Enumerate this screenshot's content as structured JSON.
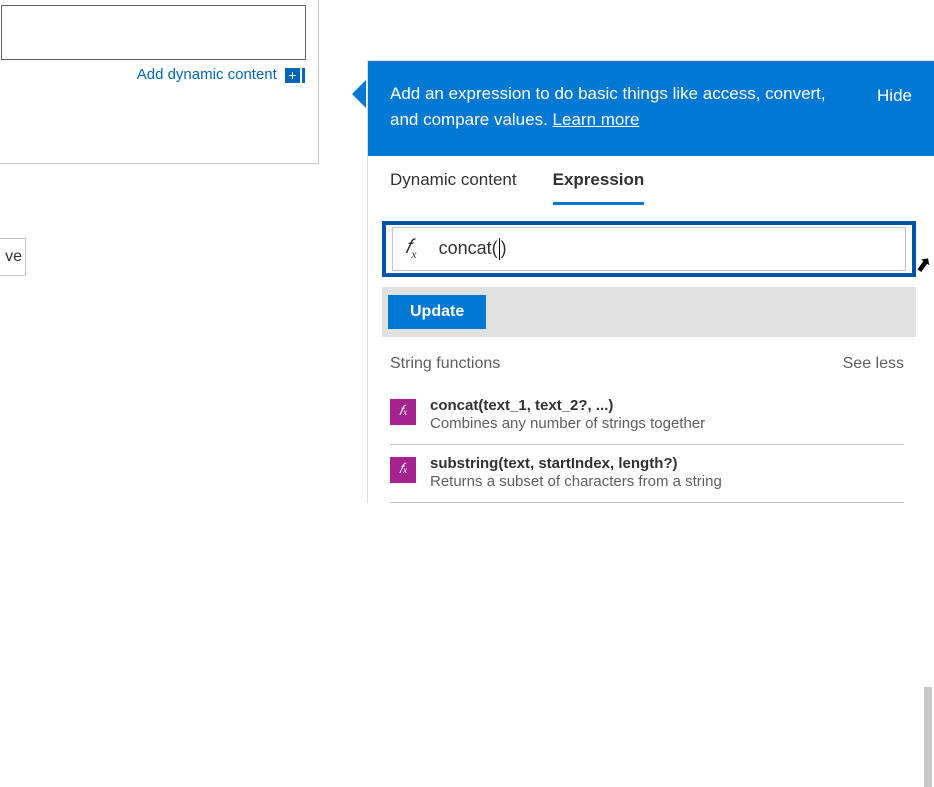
{
  "left": {
    "add_dynamic_label": "Add dynamic content",
    "save_fragment": "ve"
  },
  "banner": {
    "text_prefix": "Add an expression to do basic things like access, convert, and compare values. ",
    "learn_more": "Learn more",
    "hide": "Hide"
  },
  "tabs": {
    "dynamic": "Dynamic content",
    "expression": "Expression"
  },
  "expression": {
    "fx_label": "fx",
    "value": "concat()",
    "value_before_cursor": "concat(",
    "value_after_cursor": ")"
  },
  "buttons": {
    "update": "Update"
  },
  "functions": {
    "group_title": "String functions",
    "see_toggle": "See less",
    "items": [
      {
        "sig": "concat(text_1, text_2?, ...)",
        "desc": "Combines any number of strings together"
      },
      {
        "sig": "substring(text, startIndex, length?)",
        "desc": "Returns a subset of characters from a string"
      }
    ]
  }
}
